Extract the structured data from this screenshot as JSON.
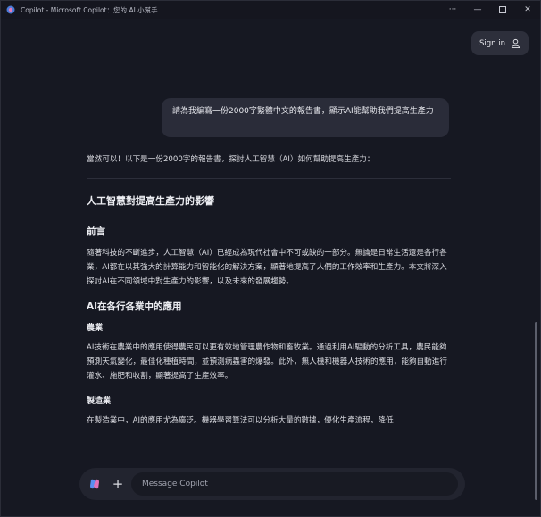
{
  "window": {
    "title": "Copilot - Microsoft Copilot：您的 AI 小幫手"
  },
  "header": {
    "signin_label": "Sign in"
  },
  "chat": {
    "user_message": "請為我編寫一份2000字繁體中文的報告書，顯示AI能幫助我們提高生產力",
    "assistant": {
      "intro": "當然可以！以下是一份2000字的報告書，探討人工智慧（AI）如何幫助提高生產力：",
      "title": "人工智慧對提高生產力的影響",
      "section1_heading": "前言",
      "section1_body": "隨著科技的不斷進步，人工智慧（AI）已經成為現代社會中不可或缺的一部分。無論是日常生活還是各行各業，AI都在以其強大的計算能力和智能化的解決方案，顯著地提高了人們的工作效率和生產力。本文將深入探討AI在不同領域中對生產力的影響，以及未來的發展趨勢。",
      "section2_heading": "AI在各行各業中的應用",
      "sub1_heading": "農業",
      "sub1_body": "AI技術在農業中的應用使得農民可以更有效地管理農作物和畜牧業。通過利用AI驅動的分析工具，農民能夠預測天氣變化，最佳化種植時間，並預測病蟲害的爆發。此外，無人機和機器人技術的應用，能夠自動進行灌水、施肥和收割，顯著提高了生產效率。",
      "sub2_heading": "製造業",
      "sub2_body": "在製造業中，AI的應用尤為廣泛。機器學習算法可以分析大量的數據，優化生產流程，降低"
    }
  },
  "composer": {
    "placeholder": "Message Copilot"
  },
  "colors": {
    "background": "#161822",
    "bubble": "#2a2c39",
    "composer": "#22242f"
  }
}
